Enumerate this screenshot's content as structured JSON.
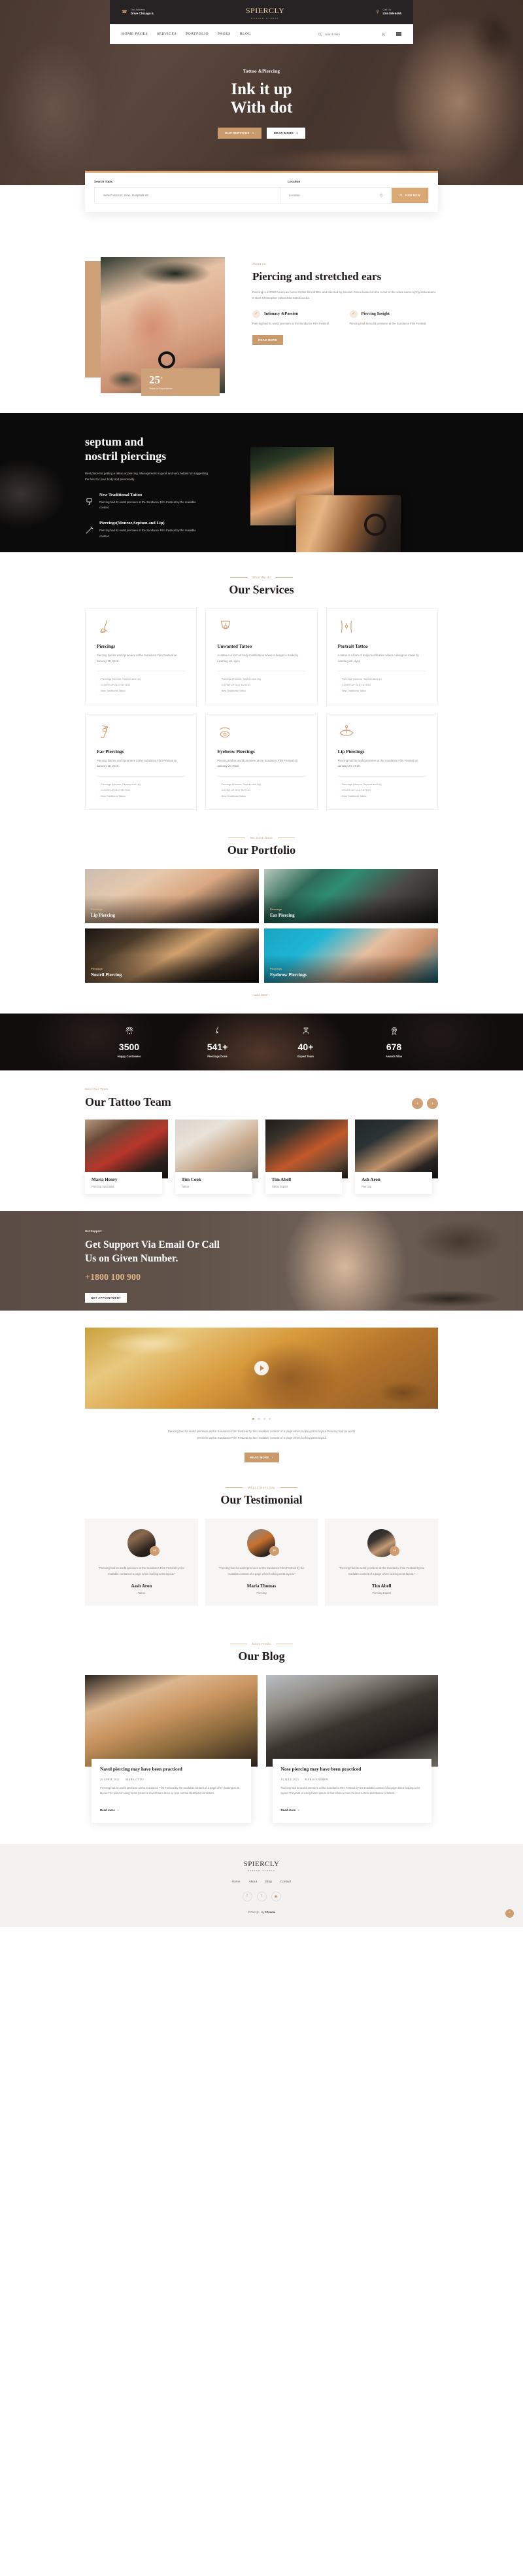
{
  "brand": {
    "name": "PIERCLY",
    "tagline": "DESIGN  STUDIO",
    "monogram": "S"
  },
  "topbar": {
    "address_label": "Our Address",
    "address_value": "Drive Chicago IL",
    "call_label": "Call Us",
    "call_value": "224-359-5495",
    "phone_icon": "phone-icon",
    "pin_icon": "map-pin-icon"
  },
  "nav": {
    "links": [
      {
        "label": "HOME PAGES"
      },
      {
        "label": "SERVICES"
      },
      {
        "label": "PORTFOLIO"
      },
      {
        "label": "PAGES"
      },
      {
        "label": "BLOG"
      }
    ],
    "search_placeholder": "search here",
    "search_icon": "search-icon",
    "account_icon": "user-icon",
    "menu_icon": "hamburger-icon"
  },
  "hero": {
    "kicker": "Tattoo &Piercing",
    "title_line1": "Ink it up",
    "title_line2": "With dot",
    "primary_btn": "OUR SERVICES",
    "secondary_btn": "READ MORE",
    "plus": "+"
  },
  "search_panel": {
    "topic_label": "Search Topic",
    "topic_placeholder": "Search doctors, clinic, Hospitals etc.",
    "location_label": "Location",
    "location_placeholder": "Location",
    "location_icon": "map-pin-icon",
    "find_label": "FIND NOW",
    "find_icon": "search-icon",
    "accent": "#d9a873"
  },
  "about": {
    "eyebrow": "About us",
    "title": "Piercing and stretched ears",
    "paragraph": "Piercing is a 2018 American horror thriller film written and directed by Nicolas Pesce,based on the novel of the same name by Ryû Murakami. It stars Christopher Abbott,Mia Wasikowska.",
    "badge_number": "25",
    "badge_sup": "+",
    "badge_label": "Years of Experience",
    "features": [
      {
        "title": "Intimacy &Passion",
        "text": "Piercing had its world premiere at the Sundance Film Festival.",
        "icon": "check-icon"
      },
      {
        "title": "Piercing Insight",
        "text": "Piercing had its world premiere at the Sundance Film Festival.",
        "icon": "check-icon"
      }
    ],
    "button": "READ MORE"
  },
  "septum": {
    "title_line1": "septum and",
    "title_line2": "nostril piercings",
    "paragraph": "Best place for getting a tattoo or piercing. Management is good and very helpful for suggesting the best for your body and personality..",
    "features": [
      {
        "title": "New Traditional Tattoo",
        "text": "Piercing had its world premiere at the Sundance Film Festival by the readable content.",
        "icon": "tattoo-machine-icon"
      },
      {
        "title": "Piercings(Monroe,Septum and Lip)",
        "text": "Piercing had its world premiere at the Sundance Film Festival by the readable content.",
        "icon": "needle-icon"
      }
    ]
  },
  "services": {
    "kicker": "What We do",
    "title": "Our Services",
    "cards": [
      {
        "icon": "nose-piercing-icon",
        "title": "Piercings",
        "text": "Piercing had its world premiere at the Sundance Film Festival on January 20, 2018",
        "list": [
          "Piercings (Monroe, Septum and Lip)",
          "COVER UP OLD TATTOO",
          "New Traditional Tattoo"
        ]
      },
      {
        "icon": "tongue-piercing-icon",
        "title": "Unwanted Tattoo",
        "text": "A tattoo is a form of body modification where a design is made by inserting ink, dyes",
        "list": [
          "Piercings (Monroe, Septum and Lip)",
          "COVER UP OLD TATTOO",
          "New Traditional Tattoo"
        ]
      },
      {
        "icon": "navel-piercing-icon",
        "title": "Portrait Tattoo",
        "text": "A tattoo is a form of body modification where a design is made by inserting ink, dyes",
        "list": [
          "Piercings (Monroe, Septum and Lip)",
          "COVER UP OLD TATTOO",
          "New Traditional Tattoo"
        ]
      },
      {
        "icon": "ear-piercing-icon",
        "title": "Ear Piercings",
        "text": "Piercing had its world premiere at the Sundance Film Festival on January 20, 2018",
        "list": [
          "Piercings (Monroe, Septum and Lip)",
          "COVER UP OLD TATTOO",
          "New Traditional Tattoo"
        ]
      },
      {
        "icon": "eyebrow-piercing-icon",
        "title": "Eyebrow Piercings",
        "text": "Piercing had its world premiere at the Sundance Film Festival on January 20, 2018",
        "list": [
          "Piercings (Monroe, Septum and Lip)",
          "COVER UP OLD TATTOO",
          "New Traditional Tattoo"
        ]
      },
      {
        "icon": "lip-piercing-icon",
        "title": "Lip Piercings",
        "text": "Piercing had its world premiere at the Sundance Film Festival on January 20, 2018",
        "list": [
          "Piercings (Monroe, Septum and Lip)",
          "COVER UP OLD TATTOO",
          "New Traditional Tattoo"
        ]
      }
    ]
  },
  "portfolio": {
    "kicker": "We Have Done",
    "title": "Our Portfolio",
    "items": [
      {
        "category": "Piercings",
        "name": "Lip Piercing"
      },
      {
        "category": "Piercings",
        "name": "Ear Piercing"
      },
      {
        "category": "Piercings",
        "name": "Nostril Piercing"
      },
      {
        "category": "Piercings",
        "name": "Eyebrow Piercings"
      }
    ],
    "load_more": "Load More"
  },
  "counters": [
    {
      "icon": "customers-icon",
      "number": "3500",
      "label": "Happy Customers"
    },
    {
      "icon": "nose-icon",
      "number": "541+",
      "label": "Piercings Done"
    },
    {
      "icon": "artist-icon",
      "number": "40+",
      "label": "Expert Team"
    },
    {
      "icon": "award-icon",
      "number": "678",
      "label": "Awards Won"
    }
  ],
  "team": {
    "kicker": "Meet Our Team",
    "title": "Our Tattoo Team",
    "prev_icon": "chevron-left-icon",
    "next_icon": "chevron-right-icon",
    "members": [
      {
        "name": "Maria Henry",
        "role": "Piercing Specialist"
      },
      {
        "name": "Tim Cook",
        "role": "Tattoo"
      },
      {
        "name": "Tim Abell",
        "role": "Tattoo Expert"
      },
      {
        "name": "Ash Aron",
        "role": "Piercing"
      }
    ]
  },
  "support": {
    "kicker": "Get Support",
    "title": "Get Support Via Email Or Call Us on Given Number.",
    "phone": "+1800 100 900",
    "button": "GET APPOINTMENT"
  },
  "video": {
    "play_icon": "play-icon",
    "dots": 4,
    "active_dot": 0,
    "paragraph": "Piercing had its world premiere at the Sundance Film Festival by the readable content of a page when looking at its layout.Piercing had its world premiere at the Sundance Film Festival by the readable content of a page when looking at its layout",
    "button": "READ MORE"
  },
  "testimonial": {
    "kicker": "What Client's Say",
    "title": "Our Testimonial",
    "items": [
      {
        "quote": "\"Piercing had its world premiere at the Sundance Film Festival by the readable content of a page when looking at its layout.\"",
        "name": "Aash Aron",
        "role": "Tattoo"
      },
      {
        "quote": "\"Piercing had its world premiere at the Sundance Film Festival by the readable content of a page when looking at its layout.\"",
        "name": "Maria Thomas",
        "role": "Piercing"
      },
      {
        "quote": "\"Piercing had its world premiere at the Sundance Film Festival by the readable content of a page when looking at its layout.\"",
        "name": "Tim Abell",
        "role": "Piercing Expert"
      }
    ]
  },
  "blog": {
    "kicker": "News Feeds",
    "title": "Our Blog",
    "posts": [
      {
        "title": "Navel piercing may have been practiced",
        "date": "20 APRIL 2021",
        "author": "MARK OTTO",
        "text": "Piercing had its world premiere at the Sundance Film Festival by the readable content of a page when looking at its layout.The point of using lorem ipsum is that it has a more-or-less normal distribution of letters.",
        "read_more": "Read more"
      },
      {
        "title": "Nose piercing may have been practiced",
        "date": "15 JULY 2021",
        "author": "MARIA ANDREW",
        "text": "Piercing had its world premiere at the Sundance Film Festival by the readable content of a page when looking at its layout.The point of using lorem ipsum is that it has a more-or-less normal distribution of letters.",
        "read_more": "Read more"
      }
    ]
  },
  "footer": {
    "nav": [
      "Home",
      "About",
      "Blog",
      "Contact"
    ],
    "social": [
      {
        "icon": "facebook-icon",
        "glyph": "f"
      },
      {
        "icon": "twitter-icon",
        "glyph": "t"
      },
      {
        "icon": "instagram-icon",
        "glyph": "◉"
      }
    ],
    "copyright_prefix": "© Piercly - By ",
    "copyright_brand": "17sucai",
    "scroll_top_icon": "chevron-up-icon"
  },
  "colors": {
    "accent": "#c89a6c",
    "accent_dark": "#cf9e70",
    "dark": "#272324",
    "panel_top": "#d9a873"
  }
}
